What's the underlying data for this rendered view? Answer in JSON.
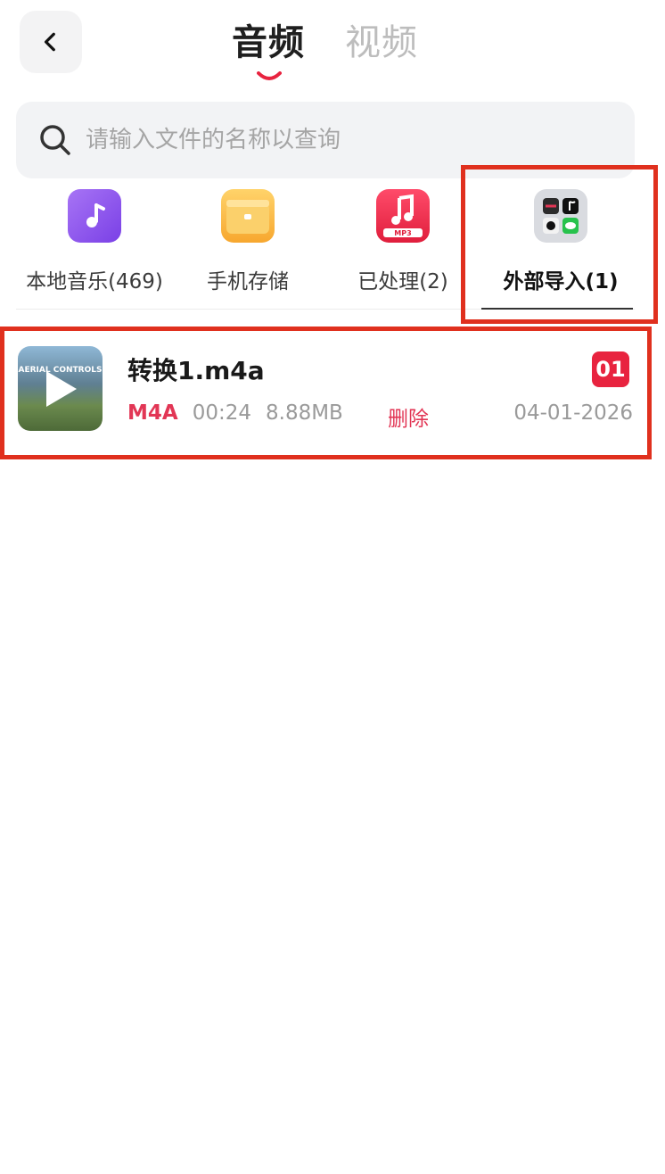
{
  "header": {
    "back_icon": "chevron-left-icon",
    "tabs": [
      {
        "label": "音频",
        "active": true
      },
      {
        "label": "视频",
        "active": false
      }
    ],
    "accent": "#e8233f"
  },
  "search": {
    "placeholder": "请输入文件的名称以查询",
    "value": "",
    "icon": "search-icon"
  },
  "categories": [
    {
      "label": "本地音乐(469)",
      "icon": "music-note-icon",
      "color": "#8b52f0"
    },
    {
      "label": "手机存储",
      "icon": "folder-icon",
      "color": "#f9b94a"
    },
    {
      "label": "已处理(2)",
      "icon": "mp3-converter-icon",
      "color": "#f13352"
    },
    {
      "label": "外部导入(1)",
      "icon": "apps-group-icon",
      "color": "#d9dbe0",
      "selected": true
    }
  ],
  "files": [
    {
      "name": "转换1.m4a",
      "format": "M4A",
      "duration": "00:24",
      "size": "8.88MB",
      "delete_label": "删除",
      "date": "04-01-2026",
      "index": "01",
      "thumb_text": "AERIAL CONTROLS"
    }
  ],
  "highlight_color": "#e0301e"
}
